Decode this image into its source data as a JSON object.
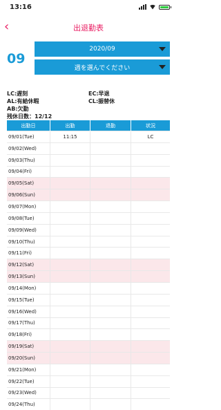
{
  "status_bar": {
    "time": "13:16"
  },
  "header": {
    "title": "出退勤表"
  },
  "selector": {
    "month_number": "09",
    "month_value": "2020/09",
    "week_placeholder": "週を選んでください"
  },
  "legend": {
    "lc": "LC:遅刻",
    "ec": "EC:早退",
    "al": "AL:有給休暇",
    "cl": "CL:振替休",
    "ab": "AB:欠勤",
    "remaining": "残休日数：12/12"
  },
  "table": {
    "headers": [
      "出勤日",
      "出勤",
      "退勤",
      "状況"
    ],
    "rows": [
      {
        "date": "09/01(Tue)",
        "in": "11:15",
        "out": "",
        "status": "LC",
        "weekend": false
      },
      {
        "date": "09/02(Wed)",
        "in": "",
        "out": "",
        "status": "",
        "weekend": false
      },
      {
        "date": "09/03(Thu)",
        "in": "",
        "out": "",
        "status": "",
        "weekend": false
      },
      {
        "date": "09/04(Fri)",
        "in": "",
        "out": "",
        "status": "",
        "weekend": false
      },
      {
        "date": "09/05(Sat)",
        "in": "",
        "out": "",
        "status": "",
        "weekend": true
      },
      {
        "date": "09/06(Sun)",
        "in": "",
        "out": "",
        "status": "",
        "weekend": true
      },
      {
        "date": "09/07(Mon)",
        "in": "",
        "out": "",
        "status": "",
        "weekend": false
      },
      {
        "date": "09/08(Tue)",
        "in": "",
        "out": "",
        "status": "",
        "weekend": false
      },
      {
        "date": "09/09(Wed)",
        "in": "",
        "out": "",
        "status": "",
        "weekend": false
      },
      {
        "date": "09/10(Thu)",
        "in": "",
        "out": "",
        "status": "",
        "weekend": false
      },
      {
        "date": "09/11(Fri)",
        "in": "",
        "out": "",
        "status": "",
        "weekend": false
      },
      {
        "date": "09/12(Sat)",
        "in": "",
        "out": "",
        "status": "",
        "weekend": true
      },
      {
        "date": "09/13(Sun)",
        "in": "",
        "out": "",
        "status": "",
        "weekend": true
      },
      {
        "date": "09/14(Mon)",
        "in": "",
        "out": "",
        "status": "",
        "weekend": false
      },
      {
        "date": "09/15(Tue)",
        "in": "",
        "out": "",
        "status": "",
        "weekend": false
      },
      {
        "date": "09/16(Wed)",
        "in": "",
        "out": "",
        "status": "",
        "weekend": false
      },
      {
        "date": "09/17(Thu)",
        "in": "",
        "out": "",
        "status": "",
        "weekend": false
      },
      {
        "date": "09/18(Fri)",
        "in": "",
        "out": "",
        "status": "",
        "weekend": false
      },
      {
        "date": "09/19(Sat)",
        "in": "",
        "out": "",
        "status": "",
        "weekend": true
      },
      {
        "date": "09/20(Sun)",
        "in": "",
        "out": "",
        "status": "",
        "weekend": true
      },
      {
        "date": "09/21(Mon)",
        "in": "",
        "out": "",
        "status": "",
        "weekend": false
      },
      {
        "date": "09/22(Tue)",
        "in": "",
        "out": "",
        "status": "",
        "weekend": false
      },
      {
        "date": "09/23(Wed)",
        "in": "",
        "out": "",
        "status": "",
        "weekend": false
      },
      {
        "date": "09/24(Thu)",
        "in": "",
        "out": "",
        "status": "",
        "weekend": false
      }
    ]
  },
  "colors": {
    "accent": "#e91e63",
    "primary": "#1a9bd7",
    "weekend_bg": "#fbe7ea"
  },
  "icons": {
    "back": "chevron-left-icon",
    "dropdown": "caret-down-icon"
  }
}
